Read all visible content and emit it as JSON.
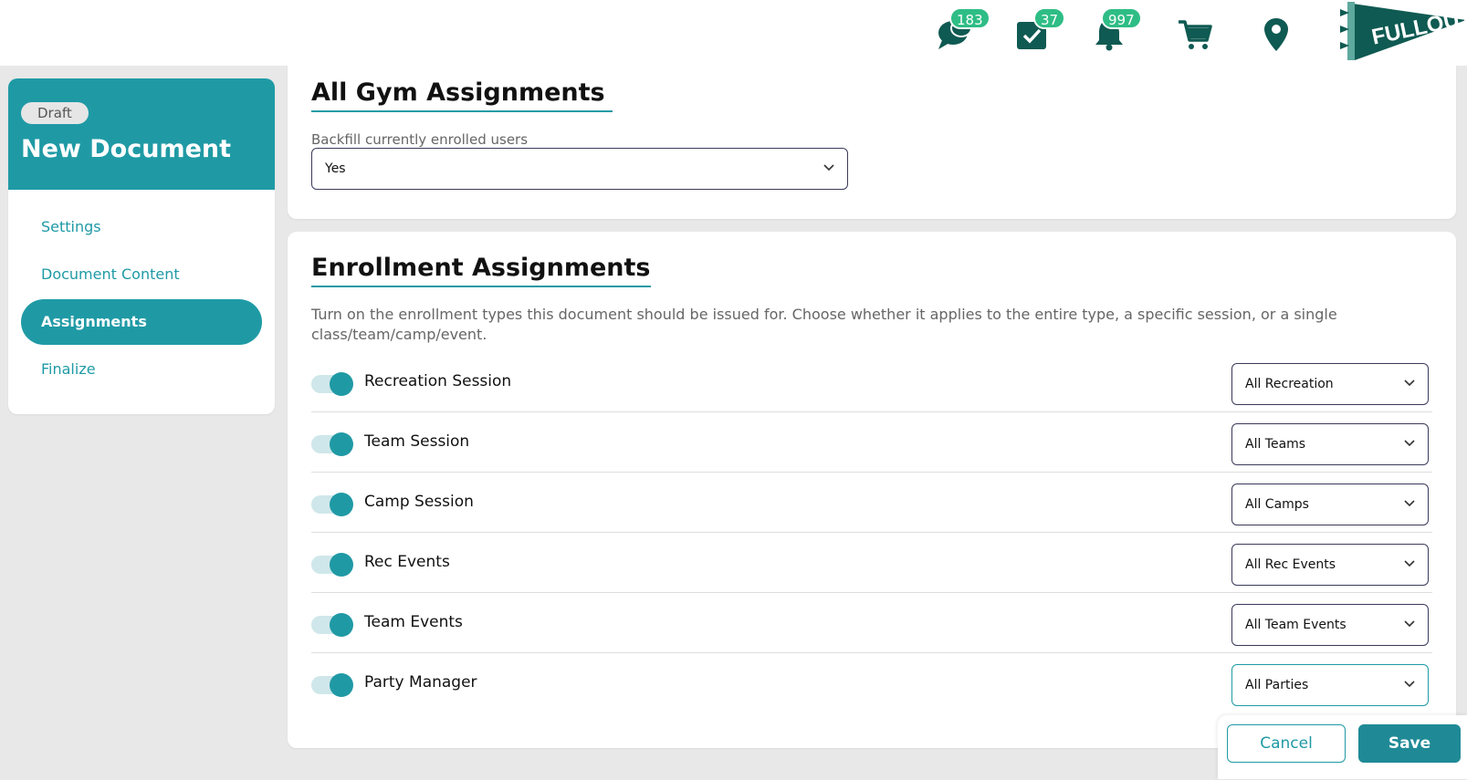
{
  "topbar": {
    "messages_count": "183",
    "tasks_count": "37",
    "notifications_count": "997",
    "logo_text": "FULLOUT"
  },
  "sidebar": {
    "status": "Draft",
    "title": "New Document",
    "items": [
      {
        "label": "Settings",
        "active": false
      },
      {
        "label": "Document Content",
        "active": false
      },
      {
        "label": "Assignments",
        "active": true
      },
      {
        "label": "Finalize",
        "active": false
      }
    ]
  },
  "gym": {
    "title": "All Gym Assignments",
    "backfill_label": "Backfill currently enrolled users",
    "backfill_value": "Yes"
  },
  "enrollment": {
    "title": "Enrollment Assignments",
    "description": "Turn on the enrollment types this document should be issued for. Choose whether it applies to the entire type, a specific session, or a single class/team/camp/event.",
    "rows": [
      {
        "label": "Recreation Session",
        "enabled": true,
        "value": "All Recreation"
      },
      {
        "label": "Team Session",
        "enabled": true,
        "value": "All Teams"
      },
      {
        "label": "Camp Session",
        "enabled": true,
        "value": "All Camps"
      },
      {
        "label": "Rec Events",
        "enabled": true,
        "value": "All Rec Events"
      },
      {
        "label": "Team Events",
        "enabled": true,
        "value": "All Team Events"
      },
      {
        "label": "Party Manager",
        "enabled": true,
        "value": "All Parties"
      }
    ]
  },
  "actions": {
    "cancel": "Cancel",
    "save": "Save"
  },
  "colors": {
    "brand": "#1f9aa5",
    "badge": "#2ebd85",
    "icon": "#0f5a52"
  }
}
